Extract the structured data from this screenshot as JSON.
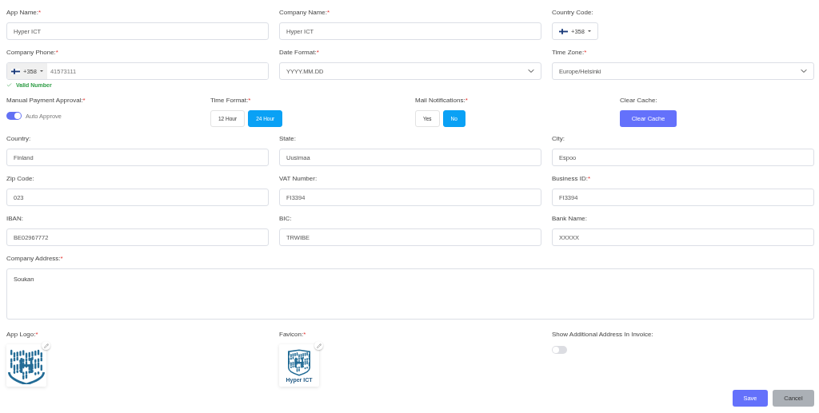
{
  "top_fields": [
    {
      "kind": "text",
      "label": "App Name:",
      "required_mark": "*",
      "value": "Hyper ICT"
    },
    {
      "kind": "text",
      "label": "Company Name:",
      "required_mark": "*",
      "value": "Hyper ICT"
    },
    {
      "kind": "country_code",
      "label": "Country Code:",
      "code": "+358"
    },
    {
      "kind": "phone",
      "label": "Company Phone:",
      "required_mark": "*",
      "code": "+358",
      "value": "41573111",
      "hint": "Valid Number"
    },
    {
      "kind": "select",
      "label": "Date Format:",
      "required_mark": "*",
      "value": "YYYY.MM.DD"
    },
    {
      "kind": "select",
      "label": "Time Zone:",
      "required_mark": "*",
      "value": "Europe/Helsinki"
    }
  ],
  "settings": [
    {
      "kind": "switch",
      "label": "Manual Payment Approval:",
      "required_mark": "*",
      "on": true,
      "text": "Auto Approve"
    },
    {
      "kind": "segmented",
      "label": "Time Format:",
      "required_mark": "*",
      "options": [
        {
          "label": "12 Hour",
          "selected": false
        },
        {
          "label": "24 Hour",
          "selected": true
        }
      ]
    },
    {
      "kind": "segmented",
      "label": "Mail Notifications:",
      "required_mark": "*",
      "options": [
        {
          "label": "Yes",
          "selected": false
        },
        {
          "label": "No",
          "selected": true
        }
      ]
    },
    {
      "kind": "button",
      "label": "Clear Cache:",
      "button": "Clear Cache"
    }
  ],
  "fields": [
    {
      "label": "Country:",
      "value": "Finland"
    },
    {
      "label": "State:",
      "value": "Uusimaa"
    },
    {
      "label": "City:",
      "value": "Espoo"
    },
    {
      "label": "Zip Code:",
      "value": "023"
    },
    {
      "label": "VAT Number:",
      "value": "FI3394"
    },
    {
      "label": "Business ID:",
      "required_mark": "*",
      "value": "FI3394"
    },
    {
      "label": "IBAN:",
      "value": "BE02967772"
    },
    {
      "label": "BIC:",
      "value": "TRWIBE"
    },
    {
      "label": "Bank Name:",
      "value": "XXXXX"
    }
  ],
  "address": {
    "label": "Company Address:",
    "required_mark": "*",
    "value": "Soukan"
  },
  "media": [
    {
      "kind": "logo",
      "label": "App Logo:",
      "required_mark": "*"
    },
    {
      "kind": "favicon",
      "label": "Favicon:",
      "required_mark": "*",
      "caption": "Hyper ICT"
    },
    {
      "kind": "switch",
      "label": "Show Additional Address In Invoice:",
      "on": false
    }
  ],
  "actions": [
    {
      "kind": "primary",
      "label": "Save"
    },
    {
      "kind": "secondary",
      "label": "Cancel"
    }
  ]
}
